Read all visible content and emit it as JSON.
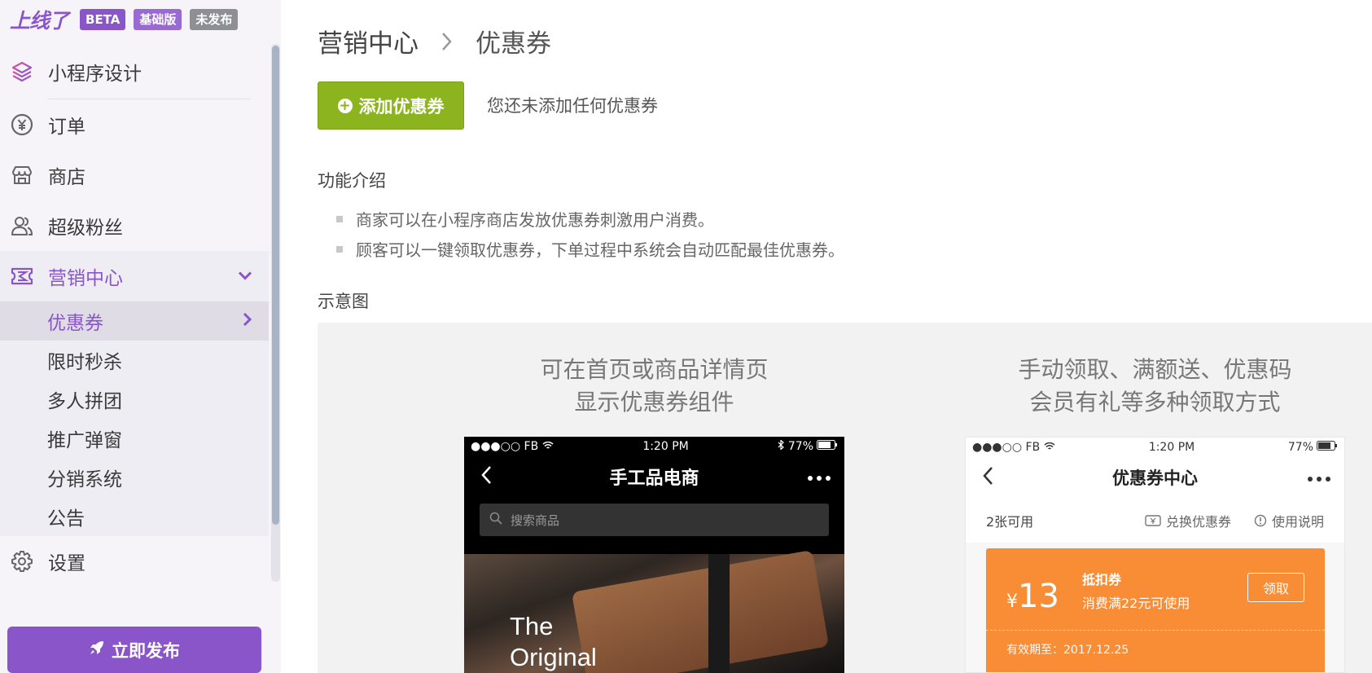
{
  "brand": {
    "logo": "上线了",
    "badges": [
      "BETA",
      "基础版",
      "未发布"
    ]
  },
  "sidebar": {
    "items": [
      {
        "label": "小程序设计",
        "icon": "layers-icon"
      },
      {
        "label": "订单",
        "icon": "yen-circle-icon"
      },
      {
        "label": "商店",
        "icon": "store-icon"
      },
      {
        "label": "超级粉丝",
        "icon": "users-icon"
      },
      {
        "label": "营销中心",
        "icon": "ticket-icon"
      },
      {
        "label": "设置",
        "icon": "gear-icon"
      }
    ],
    "submenu": [
      "优惠券",
      "限时秒杀",
      "多人拼团",
      "推广弹窗",
      "分销系统",
      "公告"
    ],
    "publish_label": "立即发布"
  },
  "colors": {
    "accent": "#8a55c9",
    "add_button": "#8bb41f",
    "coupon": "#f98d36"
  },
  "breadcrumb": {
    "parent": "营销中心",
    "current": "优惠券"
  },
  "main": {
    "add_button_label": "添加优惠券",
    "empty_tip": "您还未添加任何优惠券",
    "features_title": "功能介绍",
    "features": [
      "商家可以在小程序商店发放优惠券刺激用户消费。",
      "顾客可以一键领取优惠券，下单过程中系统会自动匹配最佳优惠券。"
    ],
    "demo_title": "示意图"
  },
  "demo": {
    "left_caption": [
      "可在首页或商品详情页",
      "显示优惠券组件"
    ],
    "right_caption": [
      "手动领取、满额送、优惠码",
      "会员有礼等多种领取方式"
    ],
    "phone1": {
      "carrier": "●●●○○ FB",
      "time": "1:20 PM",
      "battery": "77%",
      "title": "手工品电商",
      "search_placeholder": "搜索商品",
      "photo_text": [
        "The",
        "Original"
      ]
    },
    "phone2": {
      "carrier": "●●●○○ FB",
      "time": "1:20 PM",
      "battery": "77%",
      "title": "优惠券中心",
      "available": "2张可用",
      "exchange": "兑换优惠券",
      "usage": "使用说明",
      "coupon": {
        "currency": "¥",
        "amount": "13",
        "type": "抵扣券",
        "condition": "消费满22元可使用",
        "button": "领取",
        "expire": "有效期至：2017.12.25"
      }
    }
  }
}
